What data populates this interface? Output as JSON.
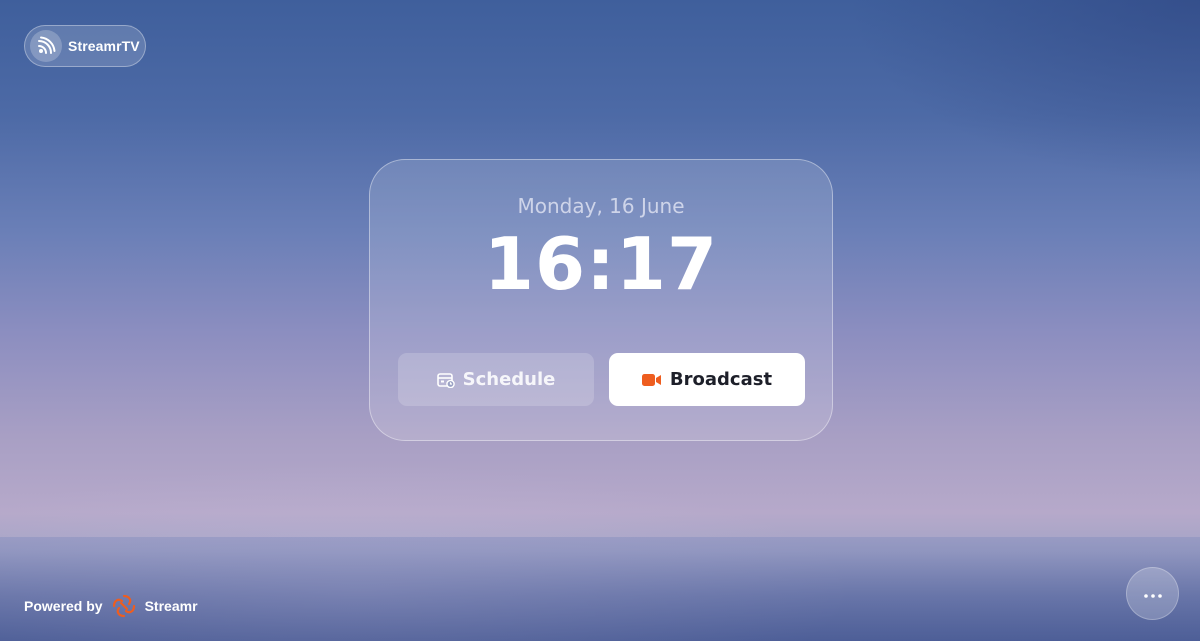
{
  "brand": {
    "name": "StreamrTV",
    "icon": "broadcast-signal-icon"
  },
  "clock": {
    "date": "Monday, 16 June",
    "time": "16:17"
  },
  "actions": {
    "schedule_label": "Schedule",
    "schedule_icon": "calendar-clock-icon",
    "broadcast_label": "Broadcast",
    "broadcast_icon": "video-camera-icon",
    "broadcast_icon_color": "#ee5d1f"
  },
  "footer": {
    "powered_by": "Powered by",
    "company": "Streamr",
    "company_logo_color": "#ee5d1f",
    "more_icon": "ellipsis-icon"
  }
}
